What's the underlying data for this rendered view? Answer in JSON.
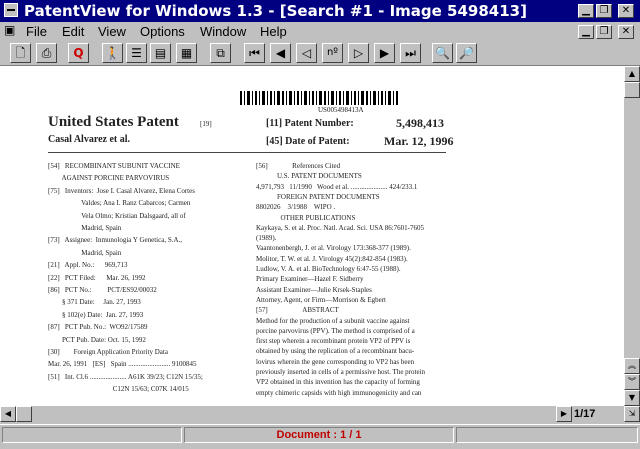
{
  "window": {
    "title": "PatentView for Windows 1.3 - [Search #1 - Image 5498413]"
  },
  "menu": {
    "items": [
      "File",
      "Edit",
      "View",
      "Options",
      "Window",
      "Help"
    ]
  },
  "toolbar": {
    "buttons": [
      "new",
      "print",
      "stop",
      "search",
      "list",
      "text",
      "image",
      "copy",
      "first",
      "prev",
      "back",
      "goto",
      "forward",
      "next",
      "last",
      "search-text",
      "find"
    ]
  },
  "doc": {
    "barcode_text": "US005498413A",
    "header_title": "United States Patent",
    "header_title_num": "[19]",
    "inventor_line": "Casal Alvarez et al.",
    "patent_number_label": "[11]   Patent Number:",
    "patent_number": "5,498,413",
    "date_label": "[45]   Date of Patent:",
    "date_value": "Mar. 12, 1996",
    "left_lines": [
      "[54]   RECOMBINANT SUBUNIT VACCINE",
      "        AGAINST PORCINE PARVOVIRUS",
      "[75]   Inventors:  Jose I. Casal Alvarez, Elena Cortes",
      "                   Valdes; Ana I. Ranz Cabarcos; Carmen",
      "                   Vela Olmo; Kristian Dalsgaard, all of",
      "                   Madrid, Spain",
      "[73]   Assignee:  Inmunologia Y Genetica, S.A.,",
      "                   Madrid, Spain",
      "[21]   Appl. No.:      969,713",
      "[22]   PCT Filed:      Mar. 26, 1992",
      "[86]   PCT No.:         PCT/ES92/00032",
      "        § 371 Date:     Jan. 27, 1993",
      "        § 102(e) Date:  Jan. 27, 1993",
      "[87]   PCT Pub. No.:  WO92/17589",
      "        PCT Pub. Date: Oct. 15, 1992",
      "[30]        Foreign Application Priority Data",
      "Mar. 26, 1991   [ES]   Spain ........................ 9100845",
      "[51]   Int. Cl.6 ..................... A61K 39/23; C12N 15/35;",
      "                                     C12N 15/63; C07K 14/015"
    ],
    "right_lines": [
      "[56]              References Cited",
      "            U.S. PATENT DOCUMENTS",
      "4,971,793   11/1990   Wood et al. ..................... 424/233.1",
      "            FOREIGN PATENT DOCUMENTS",
      "8802026    3/1988    WIPO .",
      "              OTHER PUBLICATIONS",
      "Kaykaya, S. et al. Proc. Natl. Acad. Sci. USA 86:7601-7605",
      "(1989).",
      "Vaantonenbergh, J. et al. Virology 173:368-377 (1989).",
      "Molitor, T. W. et al. J. Virology 45(2):842-854 (1983).",
      "Ludlow, V. A. et al. BioTechnology 6:47-55 (1988).",
      "Primary Examiner—Hazel F. Sidberry",
      "Assistant Examiner—Julie Krsek-Staples",
      "Attorney, Agent, or Firm—Morrison & Egbert",
      "[57]                    ABSTRACT",
      "Method for the production of a subunit vaccine against",
      "porcine parvovirus (PPV). The method is comprised of a",
      "first step wherein a recombinant protein VP2 of PPV is",
      "obtained by using the replication of a recombinant bacu-",
      "lovirus wherein the gene corresponding to VP2 has been",
      "previously inserted in cells of a permissive host. The protein",
      "VP2 obtained in this invention has the capacity of forming",
      "empty chimeric capsids with high immunogenicity and can"
    ]
  },
  "page_indicator": "1/17",
  "status": {
    "text": "Document : 1 / 1"
  }
}
